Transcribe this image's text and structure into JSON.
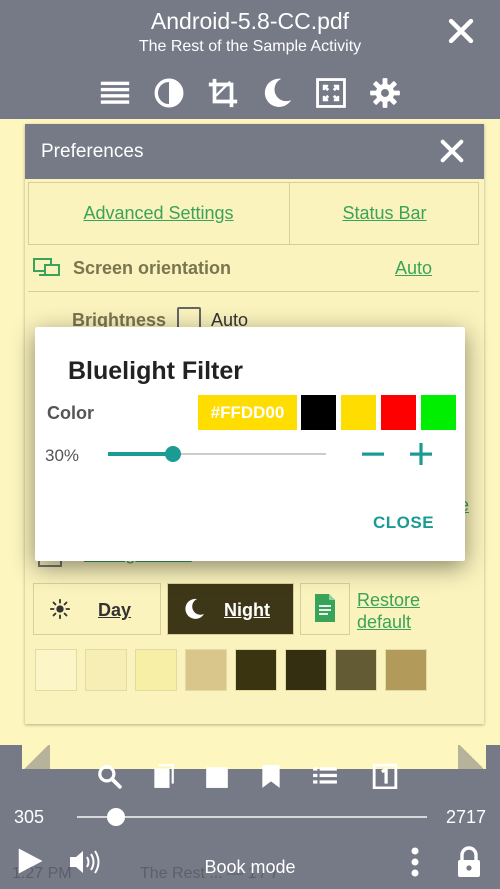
{
  "header": {
    "title": "Android-5.8-CC.pdf",
    "subtitle": "The Rest of the Sample Activity",
    "toolbar_icons": [
      "list-icon",
      "contrast-icon",
      "crop-icon",
      "moon-icon",
      "fit-screen-icon",
      "gear-icon"
    ]
  },
  "preferences": {
    "title": "Preferences",
    "tabs": [
      "Advanced Settings",
      "Status Bar"
    ],
    "screen_orientation_label": "Screen orientation",
    "screen_orientation_value": "Auto",
    "brightness_label": "Brightness",
    "brightness_auto_label": "Auto",
    "bluelight_peek_label": "Bluelight Filter",
    "peek_char": "e",
    "day_label": "Day",
    "night_label": "Night",
    "restore_label_line1": "Restore",
    "restore_label_line2": "default",
    "theme_swatches": [
      "#fcf5c7",
      "#f6eeb5",
      "#f7efa6",
      "#d9c68a",
      "#3a3411",
      "#342f10",
      "#635b34",
      "#b29a5a"
    ]
  },
  "dialog": {
    "title": "Bluelight Filter",
    "color_label": "Color",
    "hex_value": "#FFDD00",
    "selected_color": "#ffdd00",
    "swatches": [
      "#000000",
      "#ffdd00",
      "#ff0000",
      "#00ee00"
    ],
    "percent_label": "30%",
    "level": 0.3,
    "close_label": "CLOSE"
  },
  "bottom": {
    "current_page": "305",
    "total_pages": "2717",
    "progress": 0.112,
    "mode_label": "Book mode",
    "status_time": "1:27 PM",
    "status_page": "The Rest ... — 1 / 7"
  },
  "colors": {
    "bar": "#767a87",
    "paper": "#fdf6bf",
    "accent_link": "#3aa35a",
    "accent_dialog": "#1a9b93"
  }
}
